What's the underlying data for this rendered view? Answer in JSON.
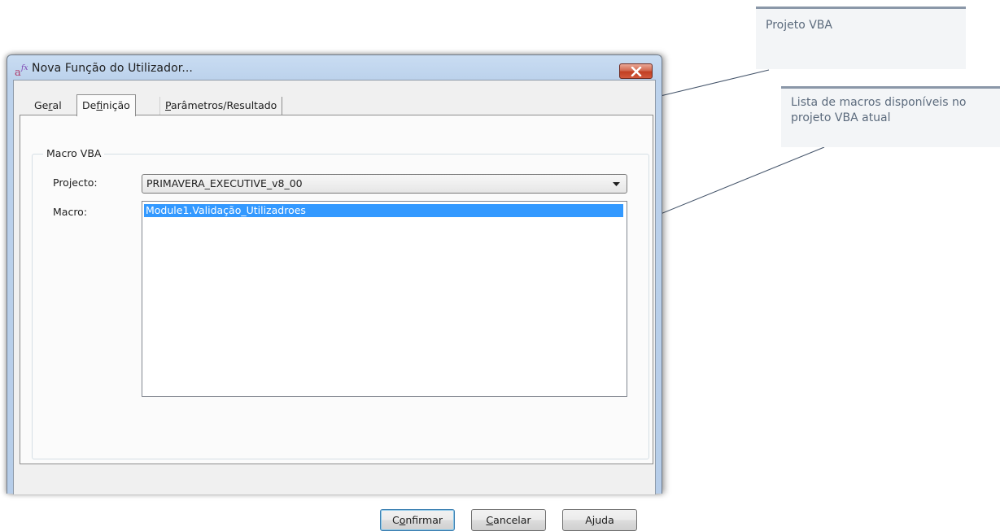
{
  "window": {
    "title": "Nova Função do Utilizador..."
  },
  "tabs": [
    {
      "pre": "Ge",
      "key": "r",
      "post": "al"
    },
    {
      "pre": "De",
      "key": "f",
      "post": "inição"
    },
    {
      "pre": "",
      "key": "P",
      "post": "arâmetros/Resultado"
    }
  ],
  "group": {
    "label": "Macro VBA",
    "project_label": "Projecto:",
    "project_value": "PRIMAVERA_EXECUTIVE_v8_00",
    "macro_label": "Macro:",
    "macros": [
      "Module1.Validação_Utilizadroes"
    ]
  },
  "buttons": {
    "confirm": {
      "pre": "C",
      "key": "o",
      "post": "nfirmar"
    },
    "cancel": {
      "pre": "",
      "key": "C",
      "post": "ancelar"
    },
    "help": {
      "pre": "A",
      "key": "j",
      "post": "uda"
    }
  },
  "callouts": {
    "vba": "Projeto VBA",
    "macros": "Lista de macros disponíveis no projeto VBA atual"
  },
  "colors": {
    "selection": "#3399ff",
    "close": "#c23f22",
    "callout_text": "#5c6b7d"
  }
}
